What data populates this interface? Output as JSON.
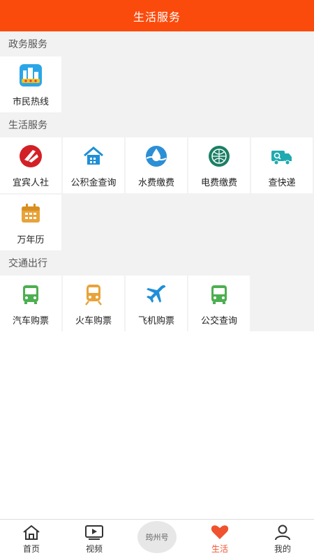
{
  "header": {
    "title": "生活服务"
  },
  "sections": {
    "gov": {
      "title": "政务服务",
      "items": [
        {
          "label": "市民热线",
          "icon": "city-hotline-icon"
        }
      ]
    },
    "life": {
      "title": "生活服务",
      "items": [
        {
          "label": "宜宾人社",
          "icon": "yibin-social-security-icon"
        },
        {
          "label": "公积金查询",
          "icon": "housing-fund-icon"
        },
        {
          "label": "水费缴费",
          "icon": "water-bill-icon"
        },
        {
          "label": "电费缴费",
          "icon": "electricity-bill-icon"
        },
        {
          "label": "查快递",
          "icon": "express-delivery-icon"
        },
        {
          "label": "万年历",
          "icon": "calendar-icon"
        }
      ]
    },
    "traffic": {
      "title": "交通出行",
      "items": [
        {
          "label": "汽车购票",
          "icon": "bus-ticket-icon"
        },
        {
          "label": "火车购票",
          "icon": "train-ticket-icon"
        },
        {
          "label": "飞机购票",
          "icon": "airplane-ticket-icon"
        },
        {
          "label": "公交查询",
          "icon": "city-bus-icon"
        }
      ]
    }
  },
  "tabbar": {
    "home": "首页",
    "video": "视频",
    "center": "筠州号",
    "life": "生活",
    "me": "我的"
  },
  "colors": {
    "brand": "#fb4b0c",
    "active": "#f0522f",
    "blue": "#1f8fd6",
    "green": "#4caf50",
    "orange": "#e8a33a"
  }
}
